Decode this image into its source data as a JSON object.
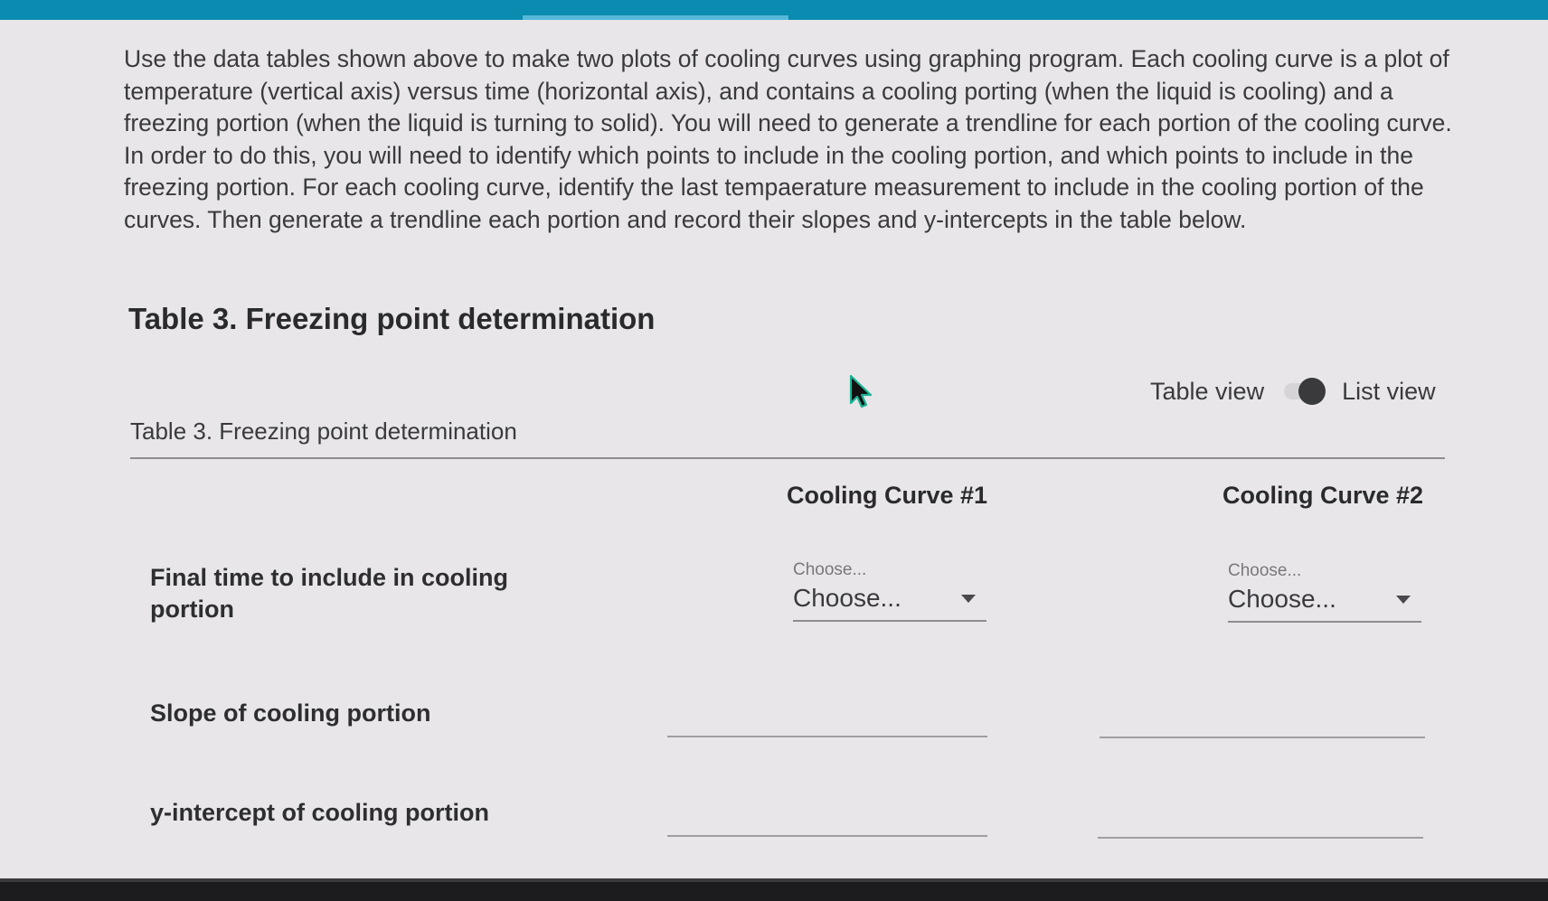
{
  "intro_text": "Use the data tables shown above to make two plots of cooling curves using graphing program. Each cooling curve is a plot of temperature (vertical axis) versus time (horizontal axis), and contains a cooling porting (when the liquid is cooling) and a freezing portion (when the liquid is turning to solid). You will need to generate a trendline for each portion of the cooling curve. In order to do this, you will need to identify which points to include in the cooling portion, and which points to include in the freezing portion. For each cooling curve, identify the last tempaerature measurement to include in the cooling portion of the curves. Then generate a trendline each portion and record their slopes and y-intercepts in the table below.",
  "heading": "Table 3. Freezing point determination",
  "view_toggle": {
    "table_view": "Table view",
    "list_view": "List view",
    "selected": "List view"
  },
  "table": {
    "caption": "Table 3. Freezing point determination",
    "columns": [
      "Cooling Curve #1",
      "Cooling Curve #2"
    ],
    "rows": [
      {
        "label": "Final time to include in cooling portion",
        "cells": [
          {
            "type": "select",
            "label": "Choose...",
            "value": "Choose..."
          },
          {
            "type": "select",
            "label": "Choose...",
            "value": "Choose..."
          }
        ]
      },
      {
        "label": "Slope of cooling portion",
        "cells": [
          {
            "type": "text",
            "value": ""
          },
          {
            "type": "text",
            "value": ""
          }
        ]
      },
      {
        "label": "y-intercept of cooling portion",
        "cells": [
          {
            "type": "text",
            "value": ""
          },
          {
            "type": "text",
            "value": ""
          }
        ]
      }
    ]
  },
  "colors": {
    "header_bar": "#0a8bb0",
    "page_bg": "#e8e6e8",
    "text": "#2e2e30",
    "cursor": "#111111",
    "cursor_outline": "#1ab394"
  }
}
